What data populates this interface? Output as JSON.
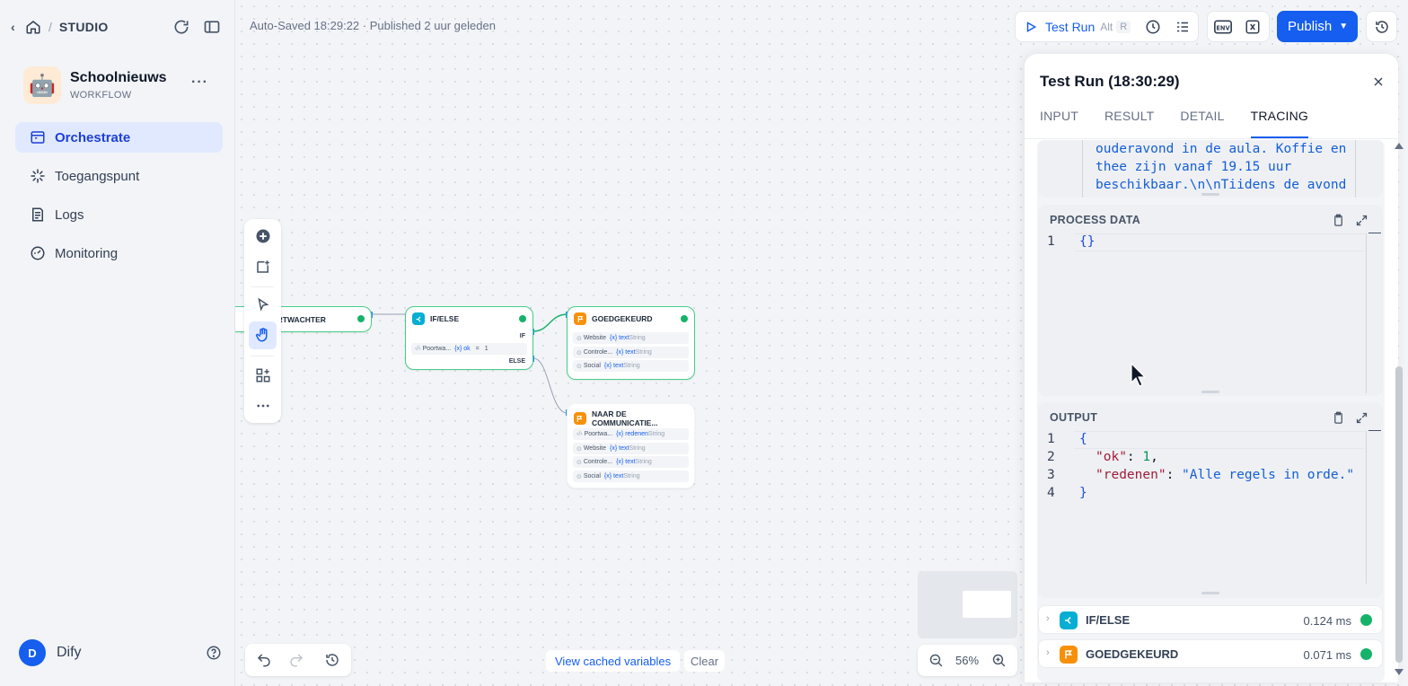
{
  "breadcrumb": {
    "studio": "STUDIO"
  },
  "app": {
    "name": "Schoolnieuws",
    "type": "WORKFLOW",
    "avatar": "🤖",
    "more": "···"
  },
  "nav": {
    "items": [
      {
        "label": "Orchestrate",
        "icon": "orchestrate-icon",
        "active": true
      },
      {
        "label": "Toegangspunt",
        "icon": "access-point-icon"
      },
      {
        "label": "Logs",
        "icon": "logs-icon"
      },
      {
        "label": "Monitoring",
        "icon": "monitoring-icon"
      }
    ]
  },
  "user": {
    "initial": "D",
    "name": "Dify"
  },
  "status": {
    "autosave": "Auto-Saved 18:29:22 · Published 2 uur geleden"
  },
  "toolbar": {
    "test_run": "Test Run",
    "kbd_alt": "Alt",
    "kbd_r": "R",
    "env": "ENV",
    "publish": "Publish"
  },
  "nodes": {
    "portwachter": {
      "title": "ORTWACHTER"
    },
    "ifelse": {
      "title": "IF/ELSE",
      "if_label": "IF",
      "else_label": "ELSE",
      "cond_source": "Poortwa...",
      "cond_var": "{x} ok",
      "cond_op": "=",
      "cond_value": "1"
    },
    "goedgekeurd": {
      "title": "GOEDGEKEURD",
      "rows": [
        {
          "name": "Website",
          "var": "{x} text",
          "type": "String"
        },
        {
          "name": "Controle...",
          "var": "{x} text",
          "type": "String"
        },
        {
          "name": "Social",
          "var": "{x} text",
          "type": "String"
        }
      ]
    },
    "communicatie": {
      "title": "NAAR DE COMMUNICATIE...",
      "rows": [
        {
          "name": "Poortwa...",
          "var": "{x} redenen",
          "type": "String"
        },
        {
          "name": "Website",
          "var": "{x} text",
          "type": "String"
        },
        {
          "name": "Controle...",
          "var": "{x} text",
          "type": "String"
        },
        {
          "name": "Social",
          "var": "{x} text",
          "type": "String"
        }
      ]
    }
  },
  "canvas": {
    "view_cached": "View cached variables",
    "clear": "Clear",
    "zoom": "56%"
  },
  "panel": {
    "title": "Test Run (18:30:29)",
    "tabs": [
      "INPUT",
      "RESULT",
      "DETAIL",
      "TRACING"
    ],
    "active_tab": "TRACING",
    "input_tail": [
      "ouderavond in de aula. Koffie en",
      "thee zijn vanaf 19.15 uur",
      "beschikbaar.\\n\\nTiidens de avond"
    ],
    "process_data": {
      "header": "PROCESS DATA",
      "line_no": "1",
      "content": "{}"
    },
    "output": {
      "header": "OUTPUT",
      "line_nos": [
        "1",
        "2",
        "3",
        "4"
      ],
      "open": "{",
      "key1": "\"ok\"",
      "val1": "1",
      "key2": "\"redenen\"",
      "val2": "\"Alle regels in orde.\"",
      "close": "}"
    },
    "trace": [
      {
        "name": "IF/ELSE",
        "time": "0.124 ms",
        "color": "#06aed4"
      },
      {
        "name": "GOEDGEKEURD",
        "time": "0.071 ms",
        "color": "#f79009"
      }
    ]
  }
}
